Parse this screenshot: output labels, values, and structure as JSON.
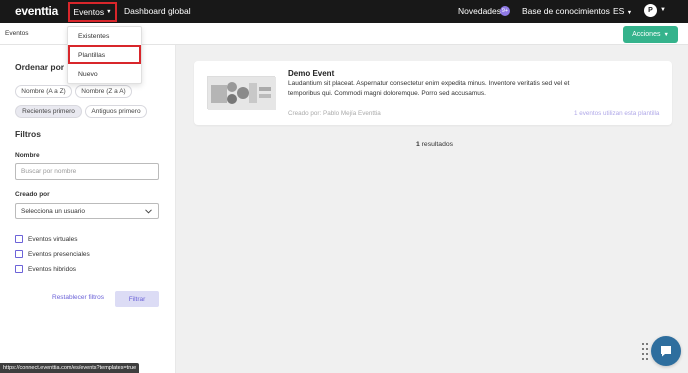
{
  "brand": {
    "logo": "eventtia"
  },
  "topnav": {
    "events_label": "Eventos",
    "global_dashboard": "Dashboard global",
    "news_label": "Novedades",
    "news_badge": "9+",
    "knowledge_base": "Base de conocimientos",
    "language": "ES",
    "avatar_initial": "P"
  },
  "breadcrumb": {
    "current": "Eventos"
  },
  "actions_label": "Acciones",
  "dropdown": {
    "items": [
      {
        "label": "Existentes"
      },
      {
        "label": "Plantillas"
      },
      {
        "label": "Nuevo"
      }
    ],
    "highlighted": "Plantillas"
  },
  "sidebar": {
    "order_title": "Ordenar por",
    "sort_options": [
      {
        "label": "Nombre (A a Z)",
        "active": false
      },
      {
        "label": "Nombre (Z a A)",
        "active": false
      },
      {
        "label": "Recientes primero",
        "active": true
      },
      {
        "label": "Antiguos primero",
        "active": false
      }
    ],
    "filters_title": "Filtros",
    "name_label": "Nombre",
    "name_placeholder": "Buscar por nombre",
    "created_by_label": "Creado por",
    "created_by_value": "Selecciona un usuario",
    "checkboxes": [
      {
        "label": "Eventos virtuales",
        "checked": false
      },
      {
        "label": "Eventos presenciales",
        "checked": false
      },
      {
        "label": "Eventos hibridos",
        "checked": false
      }
    ],
    "reset_label": "Restablecer filtros",
    "filter_label": "Filtrar"
  },
  "card": {
    "title": "Demo Event",
    "description": "Laudantium sit placeat. Aspernatur consectetur enim expedita minus. Inventore veritatis sed vel et temporibus qui. Commodi magni doloremque. Porro sed accusamus.",
    "author": "Creado por: Pablo Mejía Eventtia",
    "usage": "1 eventos utilizan esta plantilla"
  },
  "results": {
    "count": "1",
    "label": "resultados"
  },
  "status_url": "https://connect.eventtia.com/es/events?templates=true",
  "colors": {
    "topbar": "#181818",
    "accent_green": "#35b38c",
    "accent_purple": "#6c63d8",
    "highlight_red": "#d8262b"
  },
  "icons": [
    "caret-down-icon",
    "chevron-down-icon",
    "chat-icon",
    "grip-dots-icon"
  ]
}
